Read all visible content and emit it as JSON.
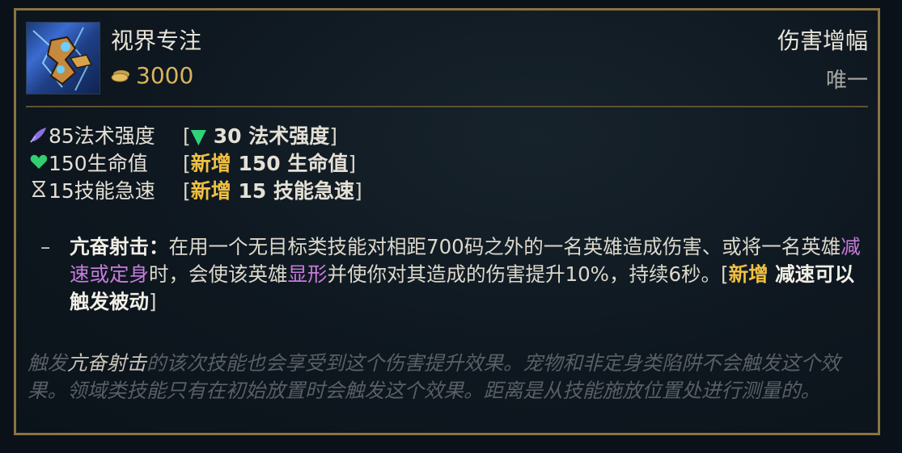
{
  "item": {
    "name": "视界专注",
    "price": "3000",
    "category": "伤害增幅",
    "unique_label": "唯一",
    "icon": "eye-focus-item-icon",
    "price_icon": "gold-coin-icon"
  },
  "stats": [
    {
      "icon": "ability-power-icon",
      "text": "85法术强度",
      "note_open": "[",
      "note_arrow": "▼",
      "note_prefix": "",
      "note_value": " 30 法术强度",
      "note_close": "]"
    },
    {
      "icon": "health-heart-icon",
      "text": "150生命值",
      "note_open": "[",
      "note_arrow": "",
      "note_prefix": "新增",
      "note_value": " 150 生命值",
      "note_close": "]"
    },
    {
      "icon": "ability-haste-hourglass-icon",
      "text": "15技能急速",
      "note_open": "[",
      "note_arrow": "",
      "note_prefix": "新增",
      "note_value": " 15 技能急速",
      "note_close": "]"
    }
  ],
  "passive": {
    "dash": "–",
    "name": "亢奋射击：",
    "text1": "在用一个无目标类技能对相距700码之外的一名英雄造成伤害、或将一名英雄",
    "kw1": "减速或定身",
    "text2": "时，会使该英雄",
    "kw2": "显形",
    "text3": "并使你对其造成的伤害提升10%，持续6秒。",
    "note_open": "[",
    "note_prefix": "新增",
    "note_value": " 减速可以触发被动",
    "note_close": "]"
  },
  "footnote": {
    "pre": "触发",
    "highlight": "亢奋射击",
    "post": "的该次技能也会享受到这个伤害提升效果。宠物和非定身类陷阱不会触发这个效果。领域类技能只有在初始放置时会触发这个效果。距离是从技能施放位置处进行测量的。"
  },
  "colors": {
    "border": "#8a7344",
    "gold": "#d9b45c",
    "new_tag": "#f0c040",
    "keyword": "#c77bdc",
    "arrow_down": "#2fd27a",
    "heart": "#2fcf72",
    "ap": "#8b6fe0"
  }
}
